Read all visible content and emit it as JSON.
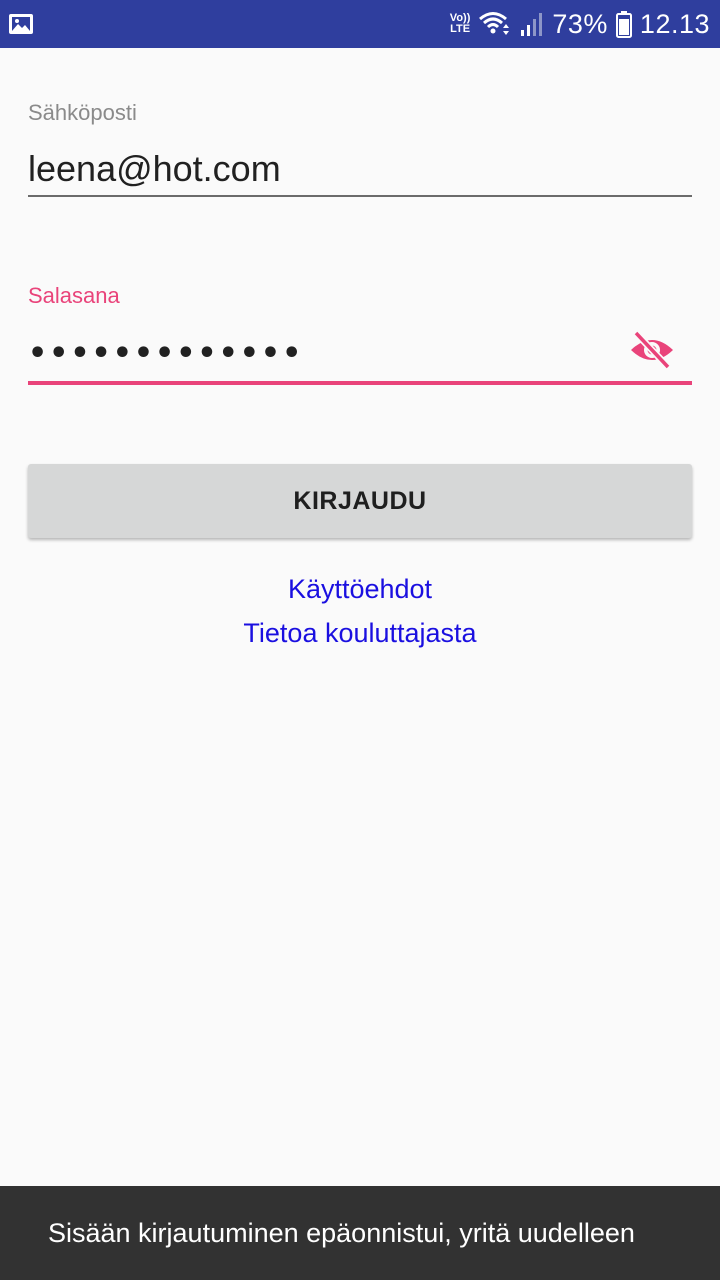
{
  "status_bar": {
    "gallery_icon": "image-icon",
    "volte_top": "Vo))",
    "volte_bottom": "LTE",
    "battery_percent": "73%",
    "time": "12.13"
  },
  "login_form": {
    "email_label": "Sähköposti",
    "email_value": "leena@hot.com",
    "password_label": "Salasana",
    "password_masked": "•••••••••••••",
    "visibility_icon": "visibility-off-icon",
    "login_button_label": "KIRJAUDU"
  },
  "links": {
    "terms": "Käyttöehdot",
    "about_trainer": "Tietoa kouluttajasta"
  },
  "snackbar": {
    "message": "Sisään kirjautuminen epäonnistui, yritä uudelleen"
  },
  "colors": {
    "status_bar": "#2f3e9e",
    "accent": "#e9437a",
    "link": "#1a0fe0",
    "button": "#d6d7d7",
    "snackbar": "#323232"
  }
}
